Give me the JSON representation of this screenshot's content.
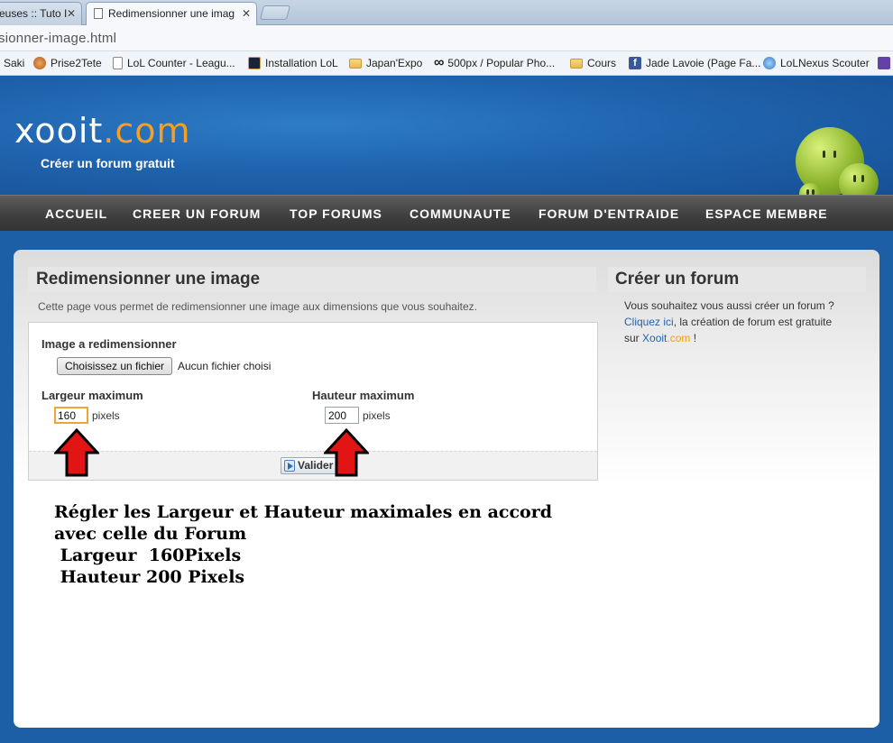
{
  "browser": {
    "tabs": [
      {
        "title": "euses :: Tuto I",
        "active": false
      },
      {
        "title": "Redimensionner une imag",
        "active": true
      }
    ],
    "url": "sionner-image.html",
    "bookmarks": [
      {
        "label": "Saki",
        "icon": "page-icon"
      },
      {
        "label": "Prise2Tete",
        "icon": "skull-icon"
      },
      {
        "label": "LoL Counter - Leagu...",
        "icon": "page-icon"
      },
      {
        "label": "Installation LoL",
        "icon": "lol-icon"
      },
      {
        "label": "Japan'Expo",
        "icon": "folder-icon"
      },
      {
        "label": "500px / Popular Pho...",
        "icon": "infinity-icon"
      },
      {
        "label": "Cours",
        "icon": "folder-icon"
      },
      {
        "label": "Jade Lavoie (Page Fa...",
        "icon": "facebook-icon"
      },
      {
        "label": "LoLNexus Scouter",
        "icon": "nexus-icon"
      }
    ]
  },
  "site": {
    "logo_main": "xooit",
    "logo_tld": ".com",
    "tagline": "Créer un forum gratuit",
    "nav": [
      "ACCUEIL",
      "CREER UN FORUM",
      "TOP FORUMS",
      "COMMUNAUTE",
      "FORUM D'ENTRAIDE",
      "ESPACE MEMBRE"
    ],
    "colors": {
      "brand_blue": "#1f64ae",
      "accent_orange": "#f5a021"
    }
  },
  "main": {
    "title": "Redimensionner une image",
    "description": "Cette page vous permet de redimensionner une image aux dimensions que vous souhaitez.",
    "image_label": "Image a redimensionner",
    "file_button": "Choisissez un fichier",
    "file_status": "Aucun fichier choisi",
    "width_label": "Largeur maximum",
    "width_value": "160",
    "height_label": "Hauteur maximum",
    "height_value": "200",
    "unit": "pixels",
    "submit": "Valider"
  },
  "annotation": {
    "line1": "Régler les Largeur et Hauteur maximales en accord",
    "line2": "avec celle du Forum",
    "line3": " Largeur  160Pixels",
    "line4": " Hauteur 200 Pixels"
  },
  "sidebar": {
    "title": "Créer un forum",
    "text1": "Vous souhaitez vous aussi créer un forum ?",
    "link": "Cliquez ici",
    "text2": ", la création de forum est gratuite",
    "text3": "sur ",
    "brand1": "Xooit",
    "brand2": ".com",
    "text4": " !"
  }
}
